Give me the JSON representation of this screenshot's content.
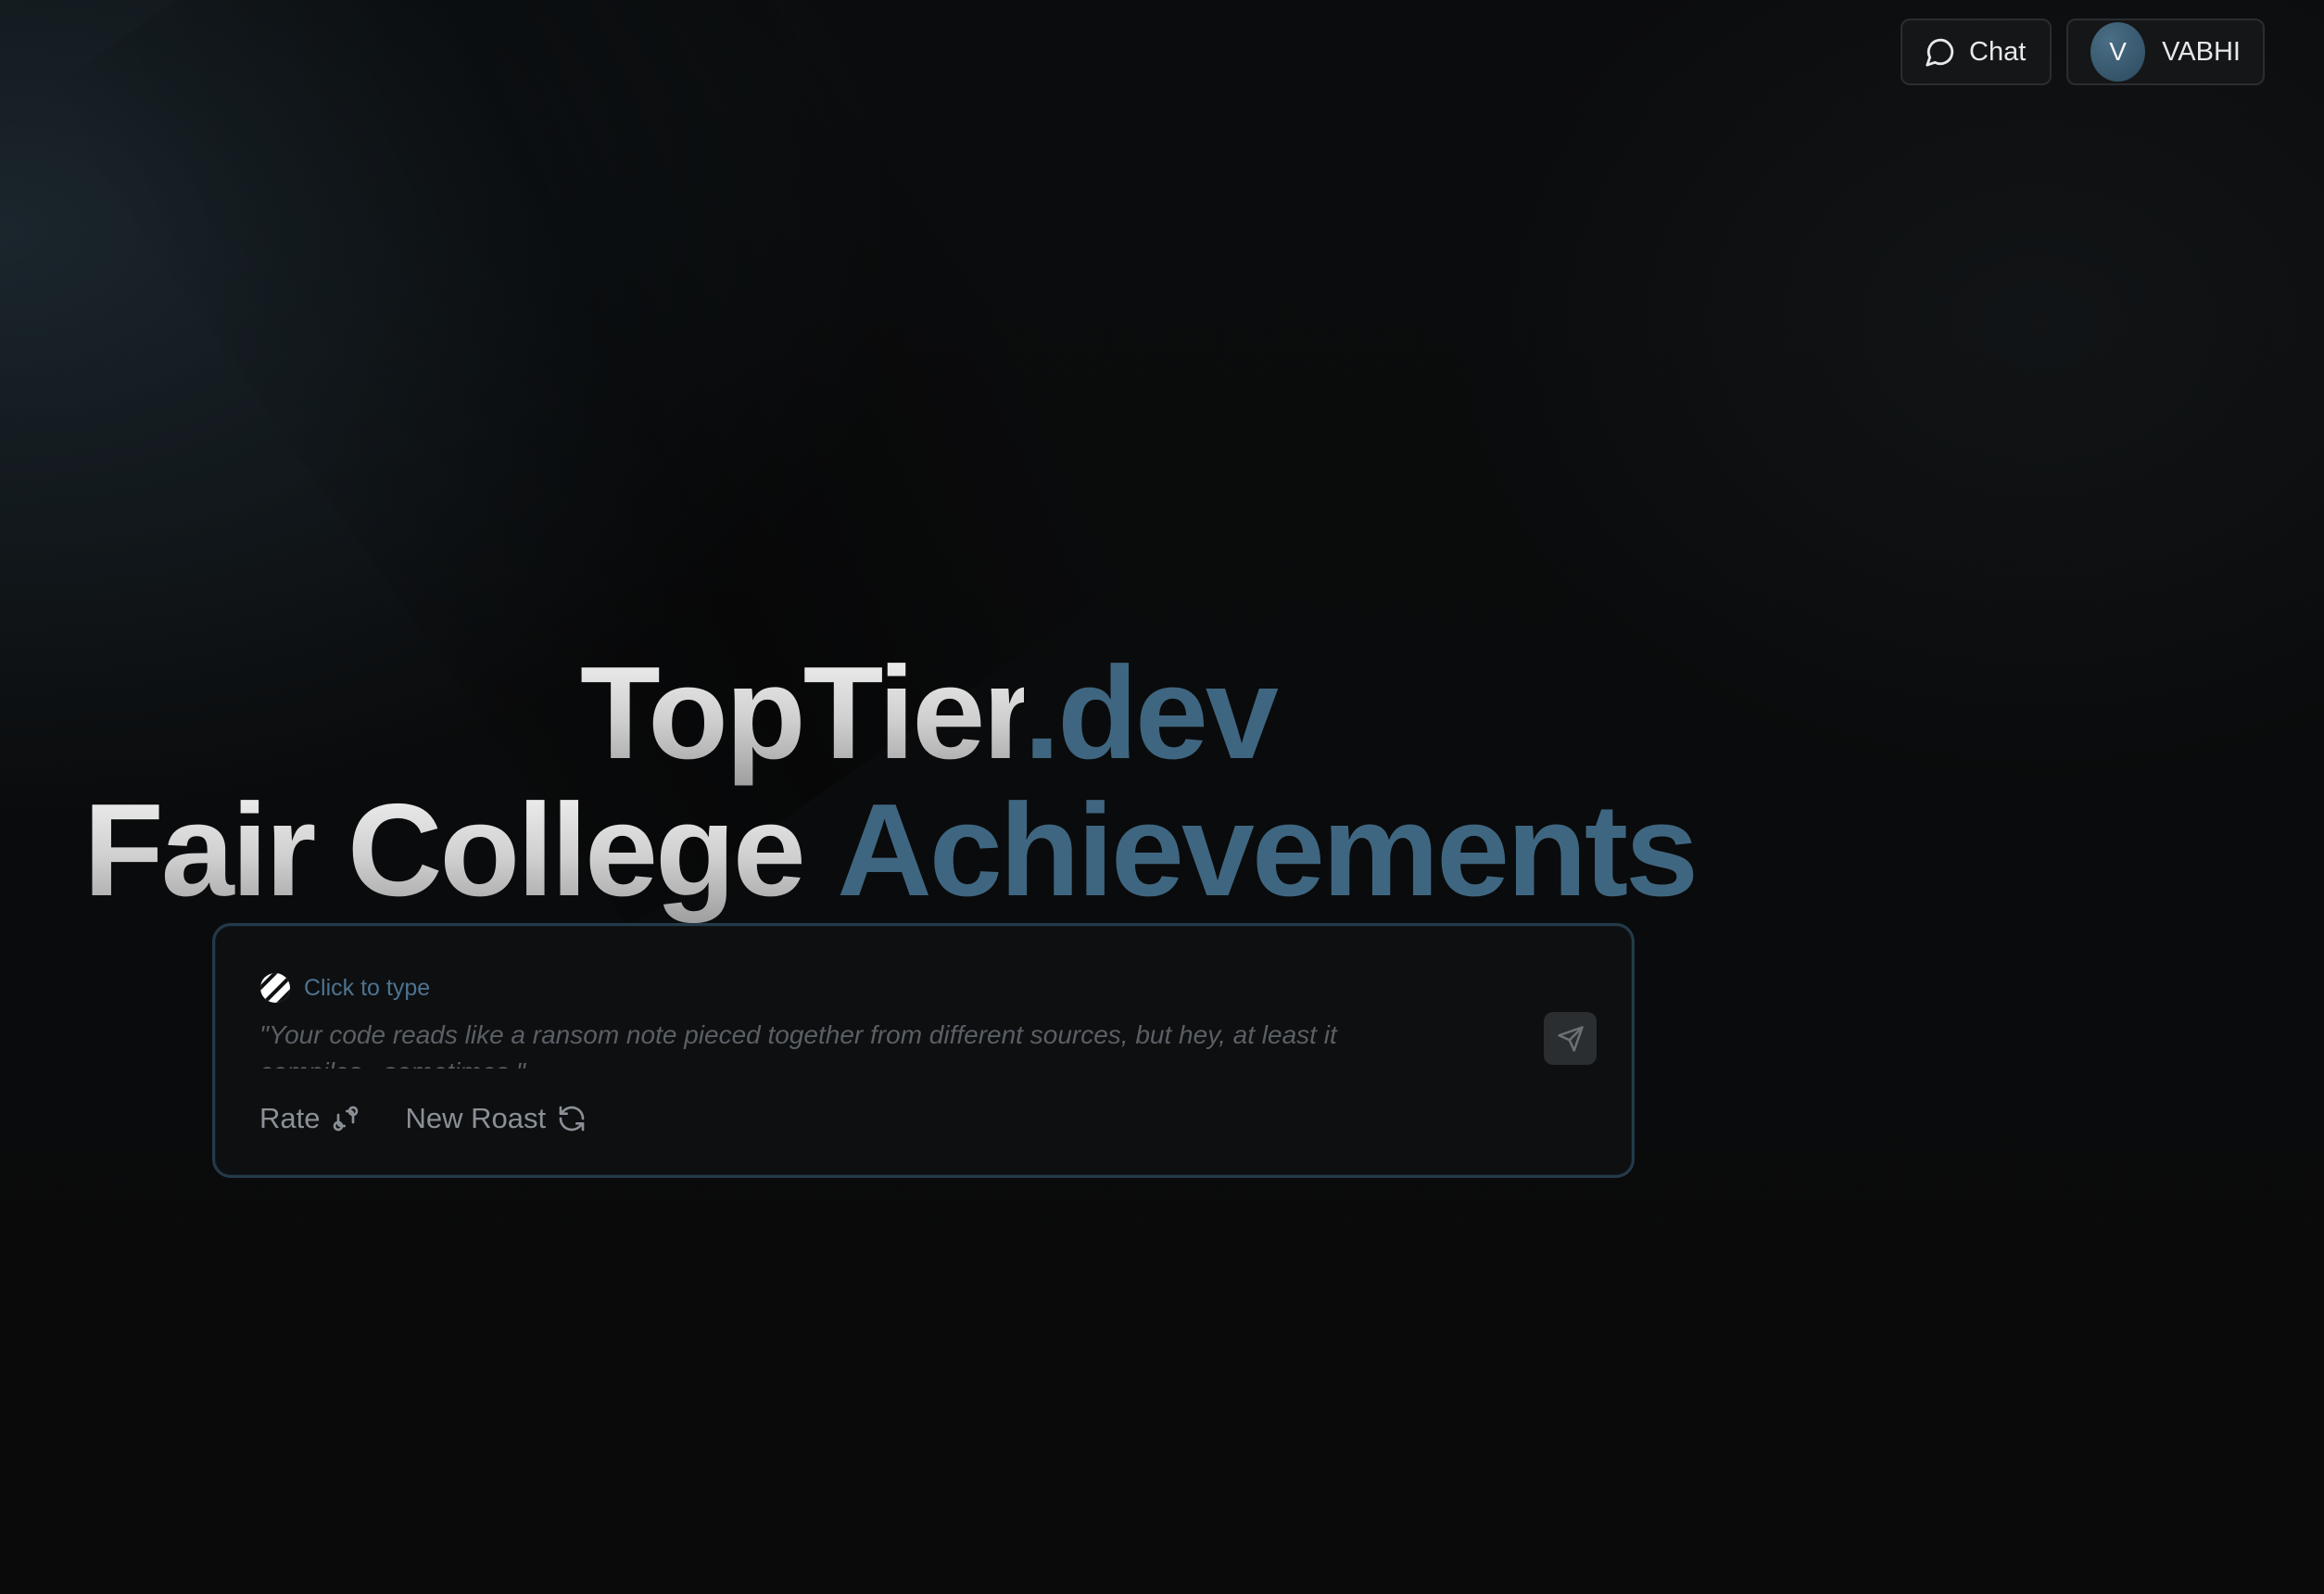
{
  "nav": {
    "chat_label": "Chat",
    "user_initial": "V",
    "user_name": "VABHI"
  },
  "headline": {
    "line1_main": "TopTier",
    "line1_accent": ".dev",
    "line2_main": "Fair College",
    "line2_accent": "Achievements"
  },
  "roast_card": {
    "hint": "Click to type",
    "roast_text": "\"Your code reads like a ransom note pieced together from different sources, but hey, at least it compiles...sometimes.\"",
    "actions": [
      {
        "label": "Rate",
        "icon": "git-compare-icon"
      },
      {
        "label": "New Roast",
        "icon": "refresh-icon"
      }
    ]
  },
  "colors": {
    "accent": "#3f6680",
    "background": "#0a0b0c",
    "card_border": "#243a4a"
  }
}
